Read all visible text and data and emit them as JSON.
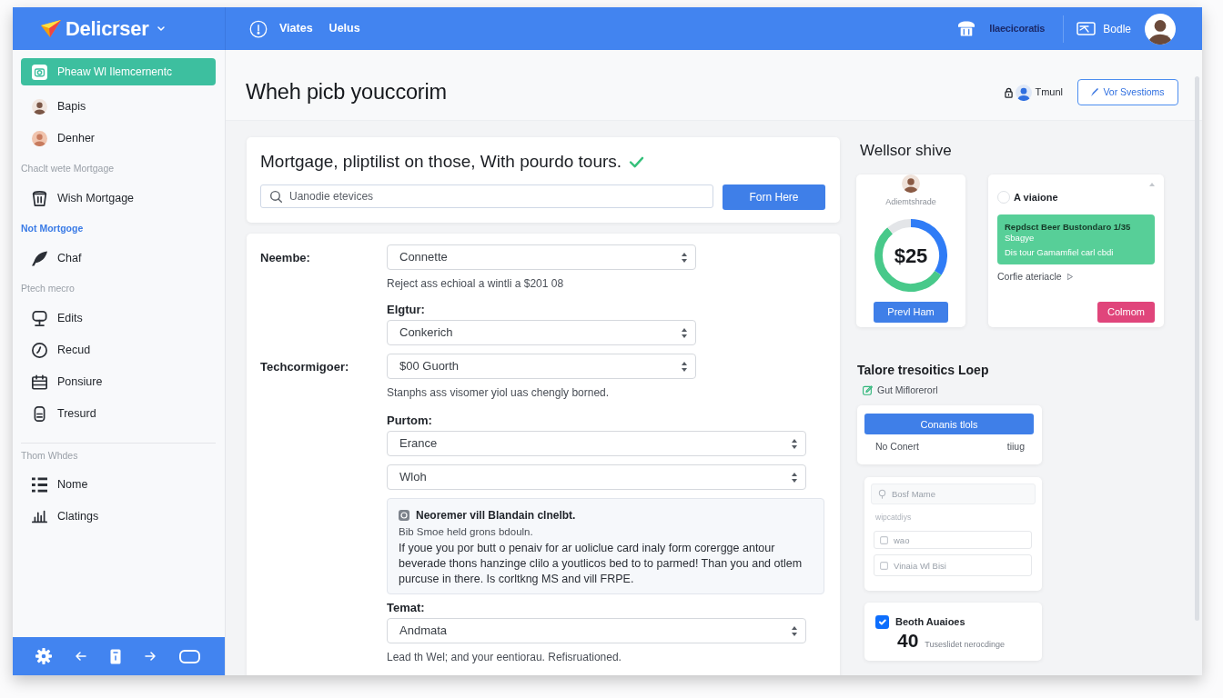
{
  "brand": {
    "name": "Delicrser"
  },
  "topbar": {
    "links": [
      {
        "label": "Viates"
      },
      {
        "label": "Uelus"
      }
    ],
    "status": "Ilaecicoratis",
    "account": "Bodle"
  },
  "sidebar": {
    "groups": [
      {
        "items": [
          {
            "kind": "icon",
            "label": "Pheaw Wl Ilemcernentc",
            "selected": true
          },
          {
            "kind": "avatar",
            "label": "Bapis",
            "selected": false
          },
          {
            "kind": "avatar",
            "label": "Denher",
            "selected": false
          }
        ]
      },
      {
        "heading": {
          "label": "Chaclt wete Mortgage",
          "active": false
        },
        "items": [
          {
            "kind": "icon",
            "label": "Wish Mortgage",
            "selected": false
          }
        ]
      },
      {
        "heading": {
          "label": "Not Mortgoge",
          "active": true
        },
        "items": [
          {
            "kind": "icon",
            "label": "Chaf",
            "selected": false
          }
        ]
      },
      {
        "heading": {
          "label": "Ptech mecro",
          "active": false
        },
        "items": [
          {
            "kind": "icon",
            "label": "Edits",
            "selected": false
          },
          {
            "kind": "icon",
            "label": "Recud",
            "selected": false
          },
          {
            "kind": "icon",
            "label": "Ponsiure",
            "selected": false
          },
          {
            "kind": "icon",
            "label": "Tresurd",
            "selected": false
          }
        ]
      },
      {
        "divider": true,
        "heading": {
          "label": "Thom Whdes",
          "active": false
        },
        "items": [
          {
            "kind": "icon",
            "label": "Nome",
            "selected": false
          },
          {
            "kind": "icon",
            "label": "Clatings",
            "selected": false
          }
        ]
      }
    ]
  },
  "page_header": {
    "title": "Wheh picb youccorim",
    "user": "Tmunl",
    "action": "Vor Svestioms"
  },
  "search_card": {
    "title": "Mortgage, pliptilist on those, With pourdo tours.",
    "verified": true,
    "search": {
      "placeholder": "Uanodie etevices"
    },
    "button": "Forn Here"
  },
  "form": {
    "sections": [
      {
        "fields": [
          {
            "kind": "inline",
            "label": "Neembe:",
            "value": "Connette",
            "help": "Reject ass echioal a wintli a $201 08"
          },
          {
            "kind": "stacked",
            "label": "Elgtur:",
            "value": "Conkerich"
          },
          {
            "kind": "inline",
            "label": "Techcormigoer:",
            "value": "$00 Guorth",
            "help": "Stanphs ass visomer yiol uas chengly borned."
          }
        ]
      },
      {
        "fields": [
          {
            "kind": "stacked",
            "label": "Purtom:",
            "value": "Erance"
          },
          {
            "kind": "stacked",
            "value": "Wloh"
          },
          {
            "kind": "note",
            "title": "Neoremer vill Blandain clnelbt.",
            "subtitle": "Bib Smoe held grons bdouln.",
            "text": "If youe you por butt o penaiv for ar uoliclue card inaly form corergge antour beverade thons hanzinge clilo a youtlicos bed to to parmed! Than you and otlem purcuse in there. Is corltkng MS and vill FRPE."
          },
          {
            "kind": "stacked",
            "label": "Temat:",
            "value": "Andmata",
            "help": "Lead th Wel; and your eentiorau. Refisruationed."
          }
        ]
      }
    ]
  },
  "summary": {
    "title": "Wellsor shive",
    "balance": {
      "caption": "Adiemtshrade",
      "amount": "$25",
      "button": "Prevl Ham"
    },
    "plan": {
      "option": {
        "label": "A viaione",
        "selected": false
      },
      "banner": [
        "Repdsct Beer Bustondaro 1/35",
        "Sbagye",
        "Dis tour Gamamfiel carl cbdi"
      ],
      "link": "Corfie ateriacle",
      "button": "Colmom"
    }
  },
  "tools": {
    "title": "Talore tresoitics Loep",
    "subtitle": "Gut Miflorerorl",
    "button": "Conanis tlols",
    "left": "No Conert",
    "right": "tiiug"
  },
  "draft": {
    "search": {
      "placeholder": "Bosf Mame"
    },
    "caption": "wipcatdiys",
    "fields": [
      {
        "placeholder": "wao"
      },
      {
        "placeholder": "Vinaia Wl Bisi"
      }
    ]
  },
  "stat": {
    "checked": true,
    "title": "Beoth Auaioes",
    "value": "40",
    "caption": "Tuseslidet nerocdinge"
  }
}
